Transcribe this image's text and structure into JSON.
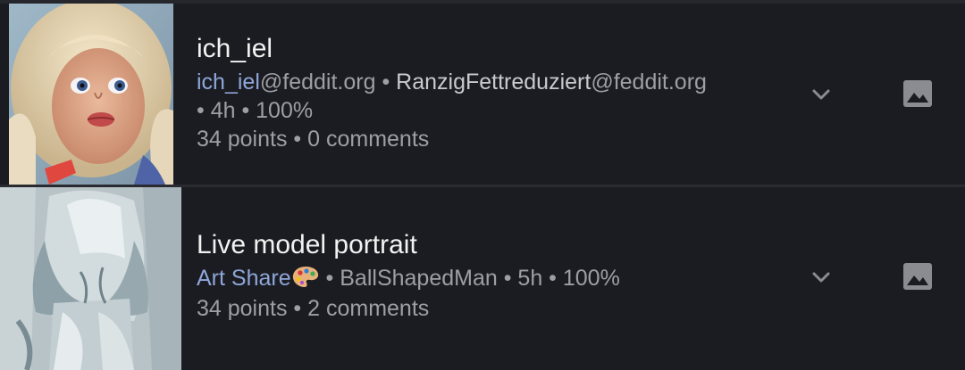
{
  "posts": [
    {
      "title": "ich_iel",
      "community": "ich_iel",
      "community_instance": "@feddit.org",
      "separator": " • ",
      "author": "RanzigFettreduziert",
      "author_instance": "@feddit.org",
      "time_line": "• 4h • 100%",
      "stats": "34 points • 0 comments",
      "thumbnail_icon": "doll-photo-thumbnail",
      "expand_icon": "chevron-down-icon",
      "media_icon": "image-icon"
    },
    {
      "title": "Live model portrait",
      "community": "Art Share",
      "community_emoji": "palette-icon",
      "rest_of_line": " • BallShapedMan • 5h • 100%",
      "author": "BallShapedMan",
      "time": "5h",
      "upvote_ratio": "100%",
      "stats": "34 points • 2 comments",
      "thumbnail_icon": "figure-painting-thumbnail",
      "expand_icon": "chevron-down-icon",
      "media_icon": "image-icon"
    }
  ],
  "colors": {
    "background": "#1b1c21",
    "title": "#f2f2f2",
    "meta": "#9e9fa4",
    "community_link": "#8ea6d9",
    "icon": "#8b8c91"
  }
}
